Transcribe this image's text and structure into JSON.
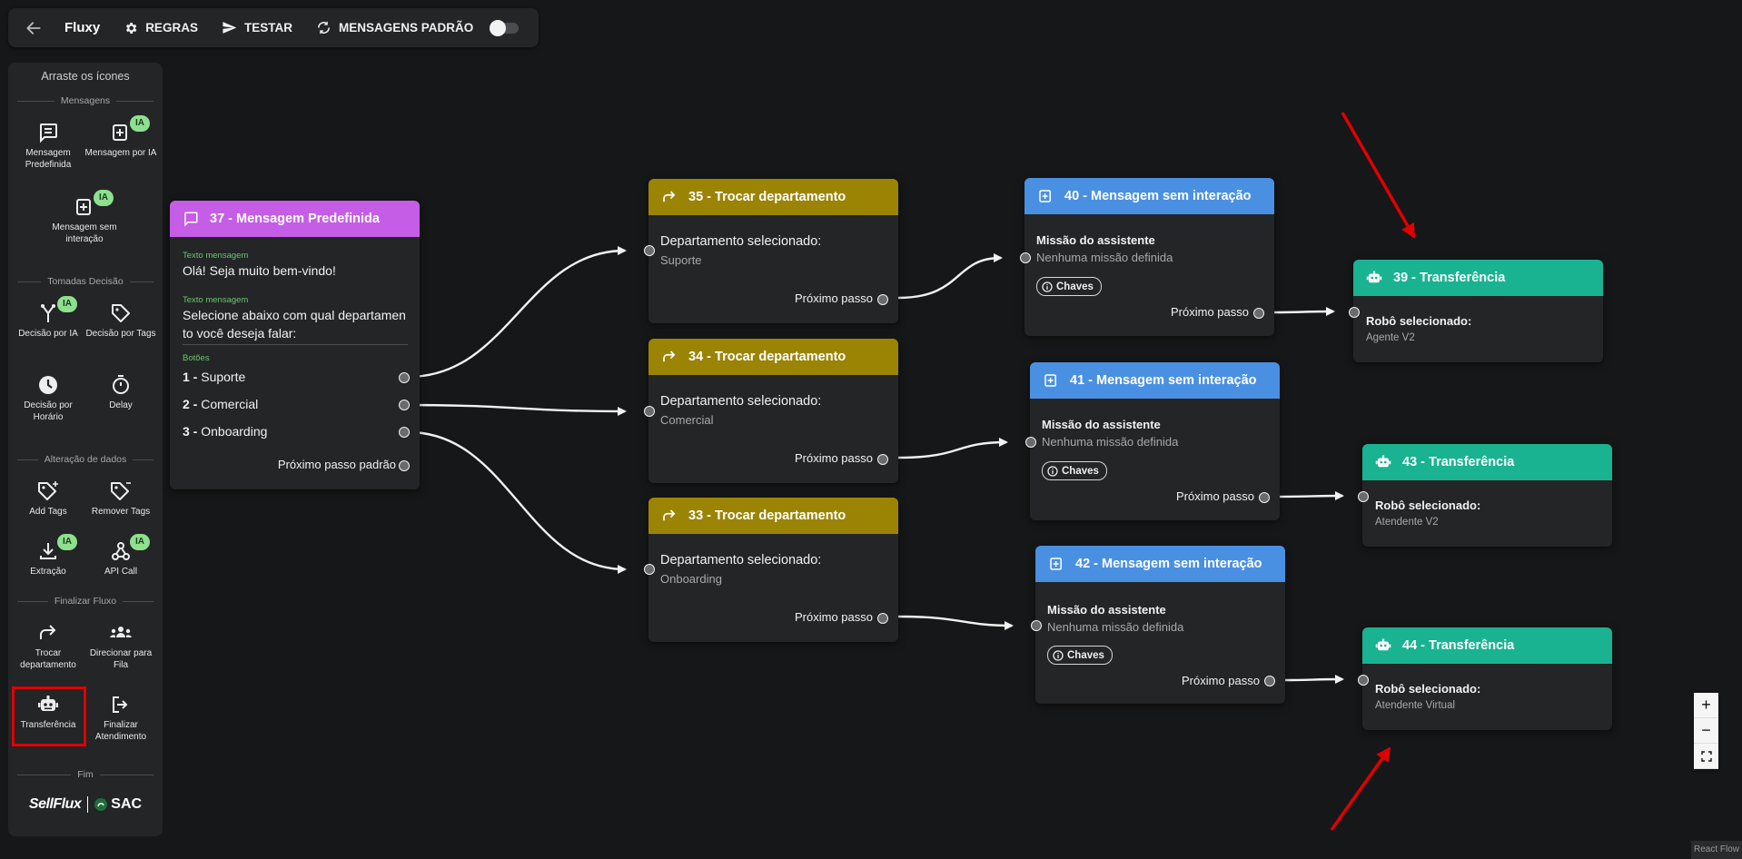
{
  "topbar": {
    "title": "Fluxy",
    "items": [
      "REGRAS",
      "TESTAR",
      "MENSAGENS PADRÃO"
    ]
  },
  "sidebar": {
    "hint": "Arraste os ícones",
    "sections": [
      "Mensagens",
      "Tomadas Decisão",
      "Alteração de dados",
      "Finalizar Fluxo",
      "Fim"
    ],
    "badge": "IA",
    "items": {
      "mensagem_predefinida": "Mensagem Predefinida",
      "mensagem_ia": "Mensagem por IA",
      "mensagem_sem_interacao": "Mensagem sem interação",
      "decisao_ia": "Decisão por IA",
      "decisao_tags": "Decisão por Tags",
      "decisao_horario": "Decisão por Horário",
      "delay": "Delay",
      "add_tags": "Add Tags",
      "remover_tags": "Remover Tags",
      "extracao": "Extração",
      "api_call": "API Call",
      "trocar_departamento": "Trocar departamento",
      "direcionar_fila": "Direcionar para Fila",
      "transferencia": "Transferência",
      "finalizar_atendimento": "Finalizar Atendimento"
    },
    "brand": {
      "sellflux": "SellFlux",
      "sac": "SAC"
    }
  },
  "nodes": {
    "n37": {
      "title": "37 - Mensagem Predefinida",
      "label_texto": "Texto mensagem",
      "msg1": "Olá! Seja muito bem-vindo!",
      "msg2_line1": "Selecione abaixo com qual departamen",
      "msg2_line2": "to você deseja falar:",
      "label_botoes": "Botões",
      "buttons": [
        {
          "num": "1 -",
          "text": "Suporte"
        },
        {
          "num": "2 -",
          "text": "Comercial"
        },
        {
          "num": "3 -",
          "text": "Onboarding"
        }
      ],
      "default_next": "Próximo passo padrão"
    },
    "n35": {
      "title": "35 - Trocar departamento",
      "label": "Departamento selecionado:",
      "value": "Suporte",
      "next": "Próximo passo"
    },
    "n34": {
      "title": "34 - Trocar departamento",
      "label": "Departamento selecionado:",
      "value": "Comercial",
      "next": "Próximo passo"
    },
    "n33": {
      "title": "33 - Trocar departamento",
      "label": "Departamento selecionado:",
      "value": "Onboarding",
      "next": "Próximo passo"
    },
    "n40": {
      "title": "40 - Mensagem sem interação",
      "label": "Missão do assistente",
      "value": "Nenhuma missão definida",
      "chaves": "Chaves",
      "next": "Próximo passo"
    },
    "n41": {
      "title": "41 - Mensagem sem interação",
      "label": "Missão do assistente",
      "value": "Nenhuma missão definida",
      "chaves": "Chaves",
      "next": "Próximo passo"
    },
    "n42": {
      "title": "42 - Mensagem sem interação",
      "label": "Missão do assistente",
      "value": "Nenhuma missão definida",
      "chaves": "Chaves",
      "next": "Próximo passo"
    },
    "n39": {
      "title": "39 - Transferência",
      "label": "Robô selecionado:",
      "value": "Agente V2"
    },
    "n43": {
      "title": "43 - Transferência",
      "label": "Robô selecionado:",
      "value": "Atendente V2"
    },
    "n44": {
      "title": "44 - Transferência",
      "label": "Robô selecionado:",
      "value": "Atendente Virtual"
    }
  },
  "zoom": {
    "in": "+",
    "out": "−"
  },
  "attribution": "React Flow",
  "colors": {
    "canvas": "#161718",
    "panel": "#232527",
    "mensagem_header": "#c55de6",
    "trocar_header": "#9b8404",
    "sem_interacao_header": "#4a90e2",
    "transferencia_header": "#19b391",
    "ia_badge": "#8ee08e",
    "highlight": "#e00000"
  }
}
